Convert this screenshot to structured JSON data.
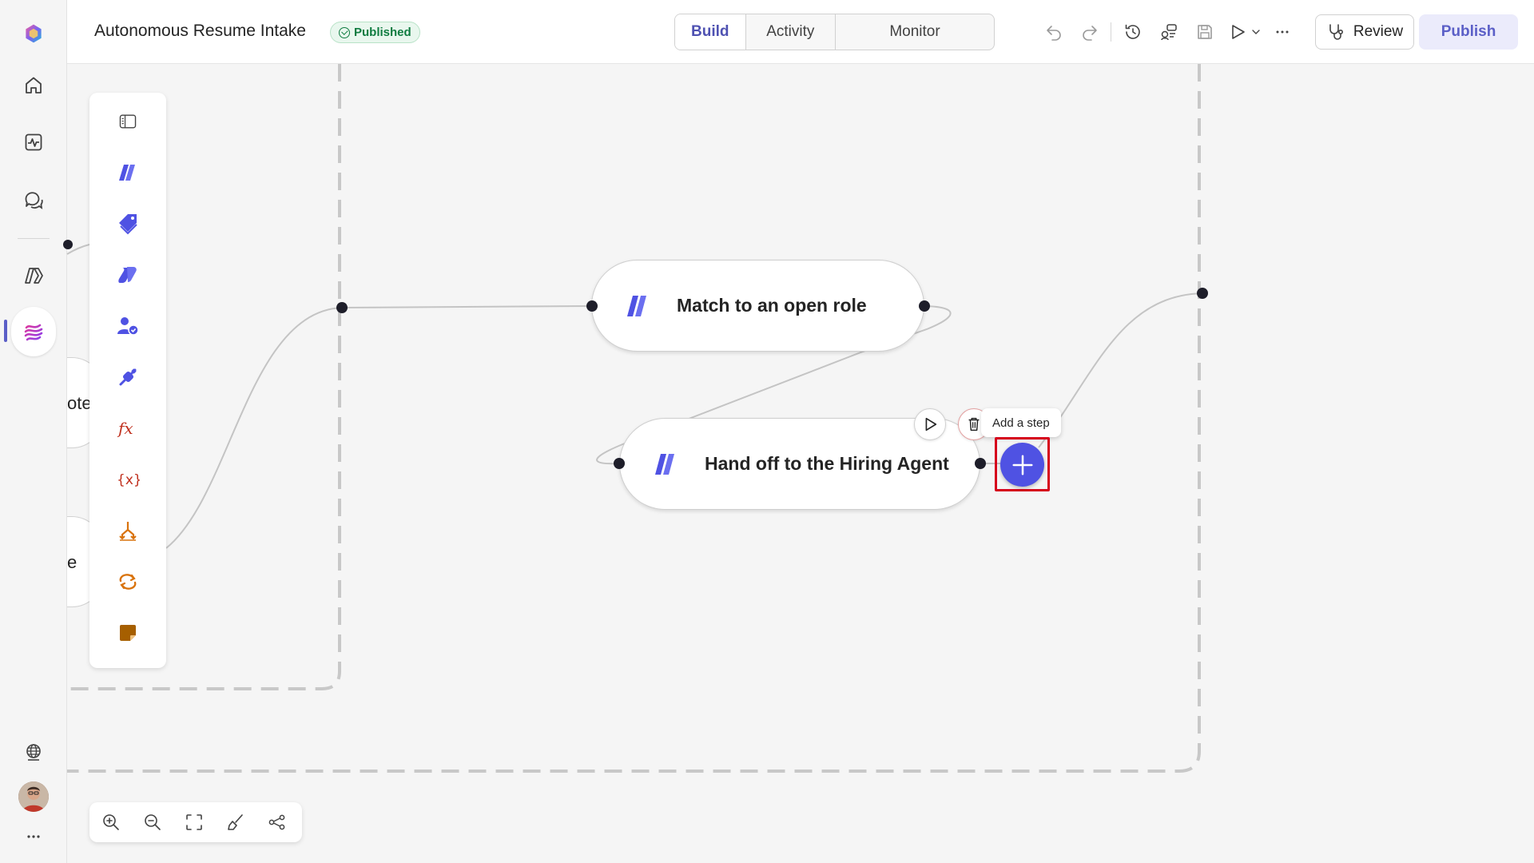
{
  "app": {
    "title": "Autonomous Resume Intake",
    "status": "Published",
    "accent": "#5b5fc7"
  },
  "tabs": [
    {
      "label": "Build",
      "active": true
    },
    {
      "label": "Activity",
      "active": false
    },
    {
      "label": "Monitor",
      "active": false
    }
  ],
  "toolbar": {
    "review_label": "Review",
    "publish_label": "Publish",
    "icons": [
      "undo-icon",
      "redo-icon",
      "history-icon",
      "connections-icon",
      "save-icon",
      "play-icon",
      "chevron-down-icon",
      "more-icon"
    ]
  },
  "rail": {
    "items": [
      "copilot-logo",
      "home-icon",
      "activity-icon",
      "chat-icon",
      "agents-icon",
      "flows-icon",
      "globe-icon",
      "avatar",
      "more-icon"
    ]
  },
  "palette": {
    "items": [
      "panel-toggle-icon",
      "agent-icon",
      "tag-icon",
      "copilot-icon",
      "human-review-icon",
      "connector-icon",
      "formula-icon",
      "variable-icon",
      "condition-icon",
      "loop-icon",
      "note-icon"
    ]
  },
  "canvas": {
    "nodes": [
      {
        "label": "Match to an open role"
      },
      {
        "label": "Hand off to the Hiring Agent"
      }
    ],
    "partial_nodes": [
      {
        "text": "ote"
      },
      {
        "text": "e"
      }
    ],
    "tooltip": "Add a step"
  },
  "zoombar": {
    "items": [
      "zoom-in-icon",
      "zoom-out-icon",
      "fit-view-icon",
      "clean-up-icon",
      "layout-icon"
    ]
  }
}
